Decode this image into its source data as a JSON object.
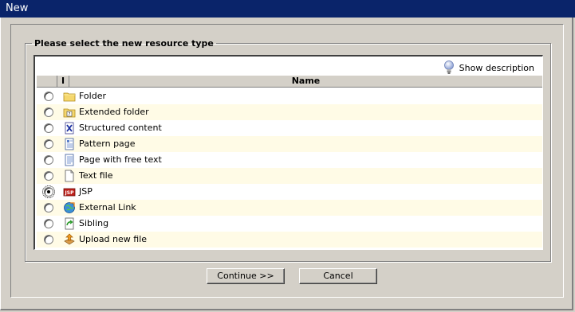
{
  "window": {
    "title": "New"
  },
  "dialog": {
    "legend": "Please select the new resource type",
    "show_description": "Show description",
    "columns": {
      "icon": "I",
      "name": "Name"
    },
    "selected_index": 6,
    "items": [
      {
        "label": "Folder",
        "icon": "folder-icon"
      },
      {
        "label": "Extended folder",
        "icon": "extended-folder-icon"
      },
      {
        "label": "Structured content",
        "icon": "structured-content-icon"
      },
      {
        "label": "Pattern page",
        "icon": "pattern-page-icon"
      },
      {
        "label": "Page with free text",
        "icon": "free-text-page-icon"
      },
      {
        "label": "Text file",
        "icon": "text-file-icon"
      },
      {
        "label": "JSP",
        "icon": "jsp-icon"
      },
      {
        "label": "External Link",
        "icon": "external-link-icon"
      },
      {
        "label": "Sibling",
        "icon": "sibling-icon"
      },
      {
        "label": "Upload new file",
        "icon": "upload-icon"
      }
    ]
  },
  "buttons": {
    "continue": "Continue >>",
    "cancel": "Cancel"
  },
  "colors": {
    "titlebar": "#0a246a",
    "face": "#d4d0c8",
    "row_alt": "#fffbe6"
  }
}
